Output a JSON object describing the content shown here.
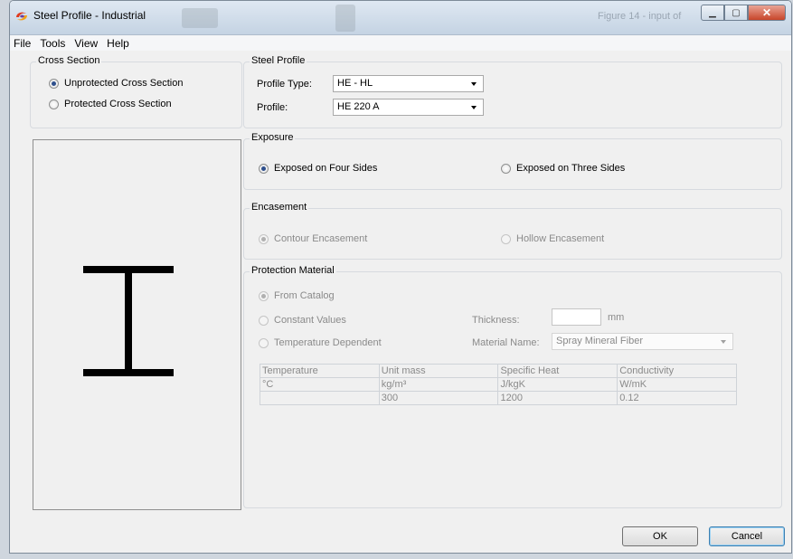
{
  "window": {
    "title": "Steel Profile - Industrial",
    "background_title": "Figure 14 - input of"
  },
  "menu": [
    "File",
    "Tools",
    "View",
    "Help"
  ],
  "cross_section": {
    "title": "Cross Section",
    "options": [
      "Unprotected Cross Section",
      "Protected Cross Section"
    ],
    "selected": "Unprotected Cross Section"
  },
  "steel_profile": {
    "title": "Steel Profile",
    "profile_type_label": "Profile Type:",
    "profile_type_value": "HE - HL",
    "profile_label": "Profile:",
    "profile_value": "HE 220 A"
  },
  "exposure": {
    "title": "Exposure",
    "options": [
      "Exposed on Four Sides",
      "Exposed on Three Sides"
    ],
    "selected": "Exposed on Four Sides"
  },
  "encasement": {
    "title": "Encasement",
    "options": [
      "Contour Encasement",
      "Hollow Encasement"
    ],
    "selected": "Contour Encasement"
  },
  "protection_material": {
    "title": "Protection Material",
    "options": [
      "From Catalog",
      "Constant Values",
      "Temperature Dependent"
    ],
    "selected": "From Catalog",
    "thickness_label": "Thickness:",
    "thickness_value": "",
    "thickness_unit": "mm",
    "material_name_label": "Material Name:",
    "material_name_value": "Spray Mineral Fiber",
    "table": {
      "headers": [
        "Temperature",
        "Unit mass",
        "Specific Heat",
        "Conductivity"
      ],
      "units": [
        "°C",
        "kg/m³",
        "J/kgK",
        "W/mK"
      ],
      "rows": [
        [
          "",
          "300",
          "1200",
          "0.12"
        ]
      ]
    }
  },
  "buttons": {
    "ok": "OK",
    "cancel": "Cancel"
  },
  "icons": {
    "app": "app-swirl-icon",
    "minimize": "minimize-icon",
    "maximize": "maximize-icon",
    "close": "close-icon"
  }
}
